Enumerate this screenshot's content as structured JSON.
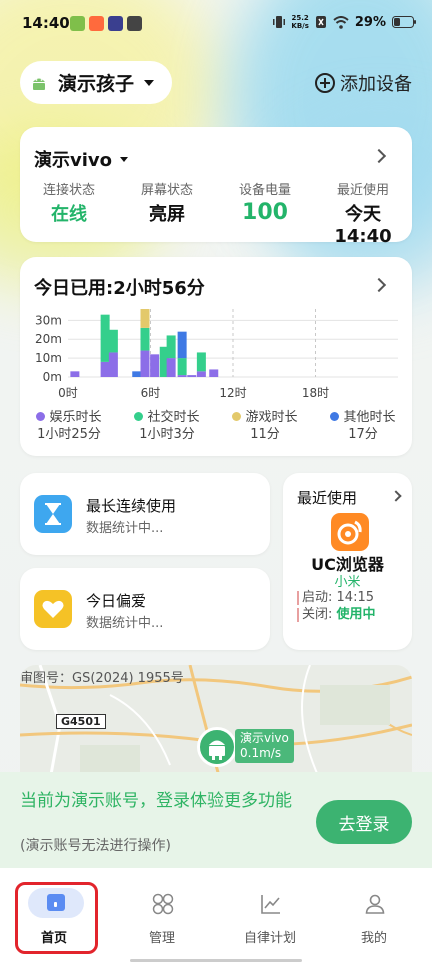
{
  "status_bar": {
    "time": "14:40",
    "speed_value": "25.2",
    "speed_unit": "KB/s",
    "battery": "29%"
  },
  "header": {
    "child_name": "演示孩子",
    "add_device_label": "添加设备"
  },
  "device_card": {
    "device_name": "演示vivo",
    "stats": [
      {
        "label": "连接状态",
        "value": "在线"
      },
      {
        "label": "屏幕状态",
        "value": "亮屏"
      },
      {
        "label": "设备电量",
        "value": "100"
      },
      {
        "label": "最近使用",
        "value": "今天 14:40"
      }
    ]
  },
  "usage_card": {
    "title": "今日已用:2小时56分",
    "legend": [
      {
        "name": "娱乐时长",
        "value": "1小时25分",
        "color": "#8c6ee8"
      },
      {
        "name": "社交时长",
        "value": "1小时3分",
        "color": "#34cf8c"
      },
      {
        "name": "游戏时长",
        "value": "11分",
        "color": "#e3c96b"
      },
      {
        "name": "其他时长",
        "value": "17分",
        "color": "#3f79e4"
      }
    ]
  },
  "chart_data": {
    "type": "bar",
    "stacked": true,
    "y_ticks": [
      "30m",
      "20m",
      "10m",
      "0m"
    ],
    "ylim": [
      0,
      36
    ],
    "x_ticks": [
      "0时",
      "6时",
      "12时",
      "18时"
    ],
    "x_tick_hours": [
      0,
      6,
      12,
      18
    ],
    "x_range_hours": [
      0,
      24
    ],
    "categories": [
      "0",
      "2",
      "3",
      "4",
      "5",
      "6",
      "7",
      "8",
      "9",
      "10",
      "11",
      "12",
      "13"
    ],
    "bar_hours": [
      0.5,
      2.7,
      3.3,
      4.6,
      5.0,
      5.6,
      6.3,
      7.0,
      7.5,
      8.3,
      9.0,
      9.7,
      10.6
    ],
    "series": [
      {
        "name": "娱乐时长",
        "color": "#8c6ee8",
        "values": [
          3,
          8,
          13,
          0,
          0,
          14,
          12,
          0,
          10,
          1,
          1,
          3,
          4
        ]
      },
      {
        "name": "社交时长",
        "color": "#34cf8c",
        "values": [
          0,
          25,
          12,
          0,
          0,
          12,
          0,
          16,
          12,
          9,
          0,
          10,
          0
        ]
      },
      {
        "name": "游戏时长",
        "color": "#e3c96b",
        "values": [
          0,
          0,
          0,
          0,
          0,
          10,
          0,
          0,
          0,
          0,
          0,
          0,
          0
        ]
      },
      {
        "name": "其他时长",
        "color": "#3f79e4",
        "values": [
          0,
          0,
          0,
          0,
          3,
          0,
          0,
          0,
          0,
          14,
          0,
          0,
          0
        ]
      }
    ]
  },
  "longest_use": {
    "title": "最长连续使用",
    "sub": "数据统计中..."
  },
  "favorite": {
    "title": "今日偏爱",
    "sub": "数据统计中..."
  },
  "recent": {
    "title": "最近使用",
    "app_name": "UC浏览器",
    "brand": "小米",
    "start_label": "启动:",
    "start_time": "14:15",
    "close_label": "关闭:",
    "close_status": "使用中"
  },
  "map": {
    "approval": "审图号：GS(2024) 1955号",
    "road": "G4501",
    "device_label": "演示vivo",
    "speed": "0.1m/s"
  },
  "login_banner": {
    "message": "当前为演示账号，登录体验更多功能",
    "note": "(演示账号无法进行操作)",
    "button": "去登录"
  },
  "tabs": [
    {
      "label": "首页",
      "icon": "home-icon",
      "active": true
    },
    {
      "label": "管理",
      "icon": "manage-icon",
      "active": false
    },
    {
      "label": "自律计划",
      "icon": "plan-chart-icon",
      "active": false
    },
    {
      "label": "我的",
      "icon": "profile-icon",
      "active": false
    }
  ],
  "colors": {
    "accent_green": "#23b46a",
    "highlight_red": "#e2242c"
  }
}
